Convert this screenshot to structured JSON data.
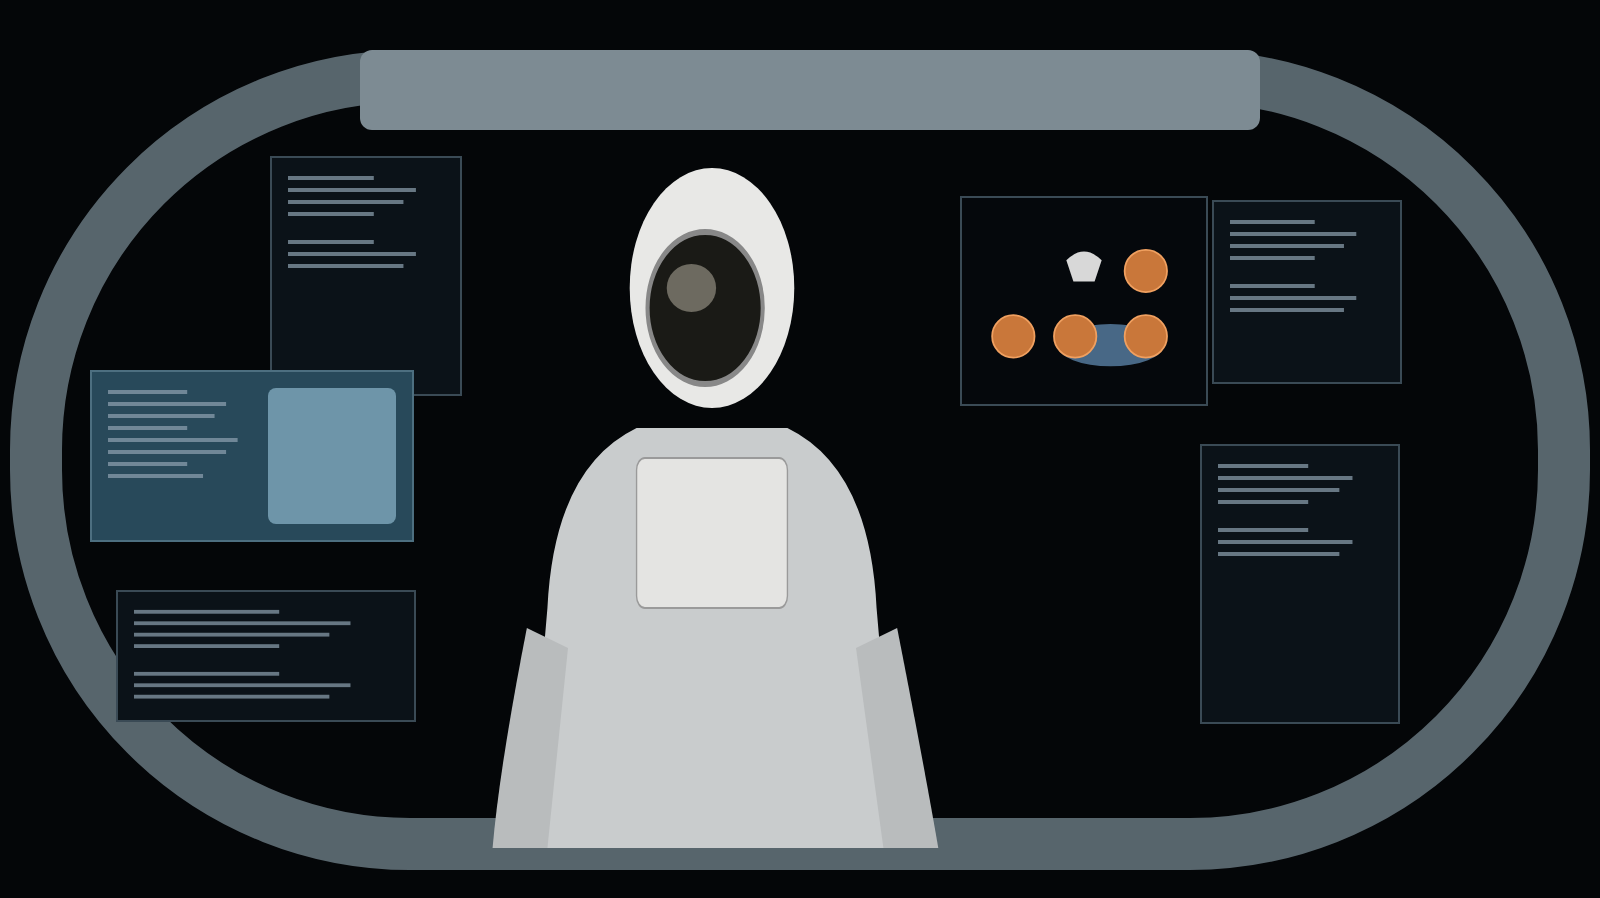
{
  "hud_panels": [
    {
      "kind": "text"
    },
    {
      "kind": "image"
    },
    {
      "kind": "text"
    },
    {
      "kind": "orbs"
    },
    {
      "kind": "text"
    },
    {
      "kind": "text"
    }
  ]
}
